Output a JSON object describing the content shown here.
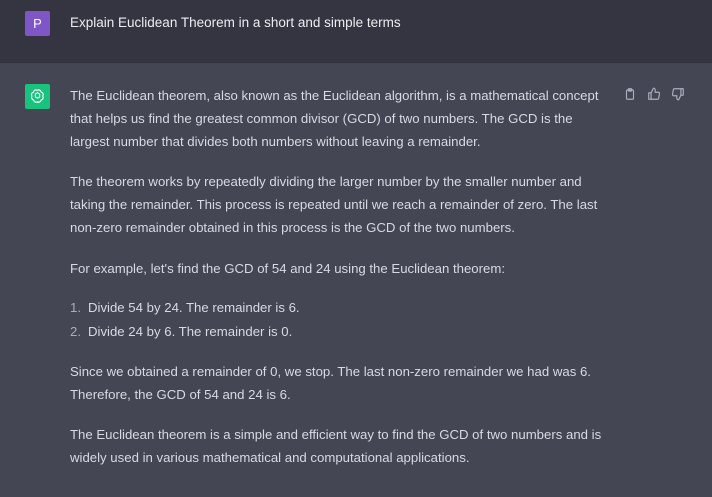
{
  "user": {
    "avatar_letter": "P",
    "message": "Explain Euclidean Theorem in a short and simple terms"
  },
  "assistant": {
    "paragraph_1": "The Euclidean theorem, also known as the Euclidean algorithm, is a mathematical concept that helps us find the greatest common divisor (GCD) of two numbers. The GCD is the largest number that divides both numbers without leaving a remainder.",
    "paragraph_2": "The theorem works by repeatedly dividing the larger number by the smaller number and taking the remainder. This process is repeated until we reach a remainder of zero. The last non-zero remainder obtained in this process is the GCD of the two numbers.",
    "paragraph_3": "For example, let's find the GCD of 54 and 24 using the Euclidean theorem:",
    "steps": [
      {
        "num": "1.",
        "text": "Divide 54 by 24. The remainder is 6."
      },
      {
        "num": "2.",
        "text": "Divide 24 by 6. The remainder is 0."
      }
    ],
    "paragraph_4": "Since we obtained a remainder of 0, we stop. The last non-zero remainder we had was 6. Therefore, the GCD of 54 and 24 is 6.",
    "paragraph_5": "The Euclidean theorem is a simple and efficient way to find the GCD of two numbers and is widely used in various mathematical and computational applications."
  },
  "icons": {
    "copy": "clipboard-icon",
    "thumbs_up": "thumbs-up-icon",
    "thumbs_down": "thumbs-down-icon",
    "assistant_logo": "openai-logo-icon"
  },
  "colors": {
    "user_bg": "#343541",
    "assistant_bg": "#444654",
    "user_avatar": "#8055c6",
    "assistant_avatar": "#19c37d"
  }
}
